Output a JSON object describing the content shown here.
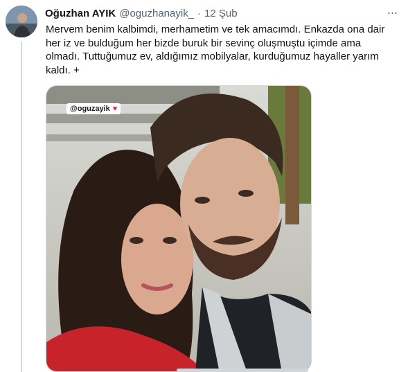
{
  "tweet": {
    "author_name": "Oğuzhan AYIK",
    "handle": "@oguzhanayik_",
    "separator": "·",
    "date": "12 Şub",
    "more_label": "···",
    "text": "Mervem benim kalbimdi, merhametim ve tek amacımdı. Enkazda ona dair\nher iz ve bulduğum her bizde buruk bir sevinç oluşmuştu içimde ama\nolmadı. Tuttuğumuz ev, aldığımız mobilyalar, kurduğumuz hayaller yarım\nkaldı. +",
    "media": {
      "sticker_text": "@oguzayik",
      "sticker_emoji": "♥"
    }
  },
  "colors": {
    "text_primary": "#0f1419",
    "text_secondary": "#536471",
    "border": "#cfd9de",
    "heart": "#e0245e"
  }
}
